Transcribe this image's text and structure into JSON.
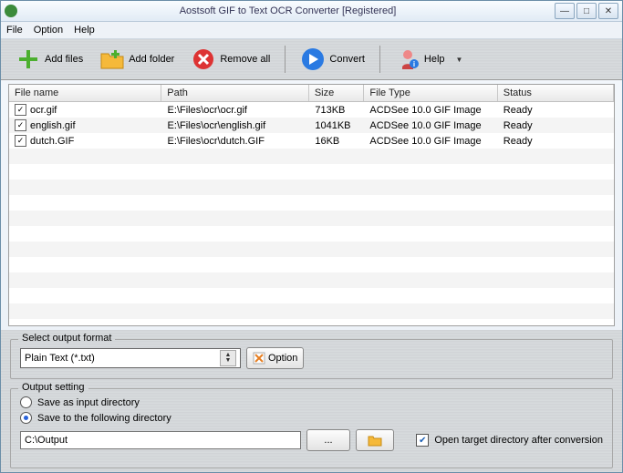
{
  "titlebar": {
    "title": "Aostsoft GIF to Text OCR Converter [Registered]"
  },
  "menu": {
    "file": "File",
    "option": "Option",
    "help": "Help"
  },
  "toolbar": {
    "add_files": "Add files",
    "add_folder": "Add folder",
    "remove_all": "Remove all",
    "convert": "Convert",
    "help": "Help"
  },
  "table": {
    "headers": {
      "name": "File name",
      "path": "Path",
      "size": "Size",
      "type": "File Type",
      "status": "Status"
    },
    "rows": [
      {
        "checked": true,
        "name": "ocr.gif",
        "path": "E:\\Files\\ocr\\ocr.gif",
        "size": "713KB",
        "type": "ACDSee 10.0 GIF Image",
        "status": "Ready"
      },
      {
        "checked": true,
        "name": "english.gif",
        "path": "E:\\Files\\ocr\\english.gif",
        "size": "1041KB",
        "type": "ACDSee 10.0 GIF Image",
        "status": "Ready"
      },
      {
        "checked": true,
        "name": "dutch.GIF",
        "path": "E:\\Files\\ocr\\dutch.GIF",
        "size": "16KB",
        "type": "ACDSee 10.0 GIF Image",
        "status": "Ready"
      }
    ]
  },
  "output_format": {
    "group_title": "Select output format",
    "selected": "Plain Text (*.txt)",
    "option_btn": "Option"
  },
  "output_setting": {
    "group_title": "Output setting",
    "opt_input_dir": "Save as input directory",
    "opt_following": "Save to the following directory",
    "selected": "following",
    "path": "C:\\Output",
    "open_after": "Open target directory after conversion",
    "open_after_checked": true
  }
}
